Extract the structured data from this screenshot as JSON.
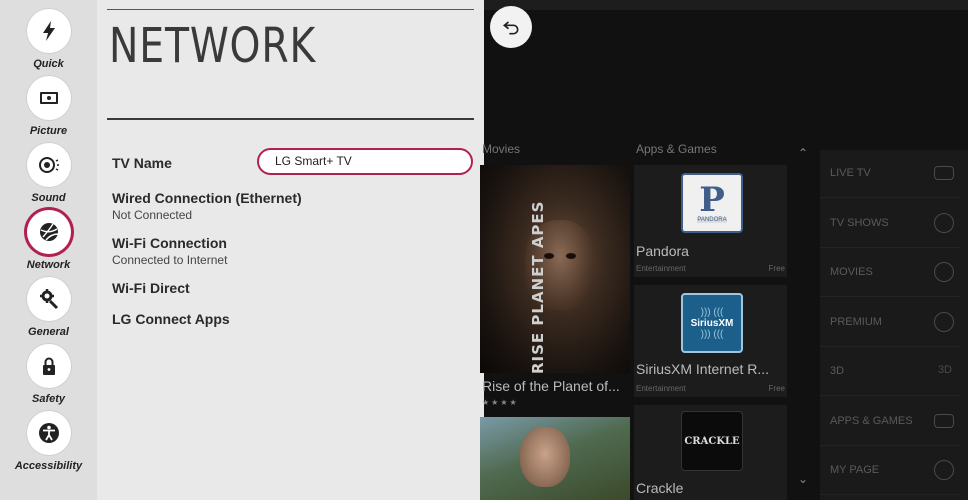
{
  "sidebar": {
    "items": [
      {
        "label": "Quick",
        "icon": "lightning-icon",
        "active": false
      },
      {
        "label": "Picture",
        "icon": "picture-icon",
        "active": false
      },
      {
        "label": "Sound",
        "icon": "sound-icon",
        "active": false
      },
      {
        "label": "Network",
        "icon": "network-globe-icon",
        "active": true
      },
      {
        "label": "General",
        "icon": "general-gear-icon",
        "active": false
      },
      {
        "label": "Safety",
        "icon": "lock-icon",
        "active": false
      },
      {
        "label": "Accessibility",
        "icon": "accessibility-icon",
        "active": false
      }
    ]
  },
  "panel": {
    "title": "NETWORK",
    "tv_name": {
      "label": "TV Name",
      "value": "LG Smart+ TV"
    },
    "wired": {
      "label": "Wired Connection (Ethernet)",
      "status": "Not Connected"
    },
    "wifi": {
      "label": "Wi-Fi Connection",
      "status": "Connected to Internet"
    },
    "wifi_direct": {
      "label": "Wi-Fi Direct"
    },
    "lg_connect": {
      "label": "LG Connect Apps"
    }
  },
  "background": {
    "sections": {
      "movies": "Movies",
      "apps": "Apps & Games"
    },
    "movies": [
      {
        "title": "Rise of the Planet of...",
        "poster_text": "RISE PLANET APES",
        "rating": 4
      }
    ],
    "apps": [
      {
        "name": "Pandora",
        "category": "Entertainment",
        "price": "Free",
        "logo_text": "PANDORA"
      },
      {
        "name": "SiriusXM Internet R...",
        "category": "Entertainment",
        "price": "Free",
        "logo_text": "SiriusXM"
      },
      {
        "name": "Crackle",
        "logo_text": "CRACKLE"
      }
    ],
    "categories": [
      "LIVE TV",
      "TV SHOWS",
      "MOVIES",
      "PREMIUM",
      "3D",
      "APPS & GAMES",
      "MY PAGE"
    ],
    "category_badge_3d": "3D"
  },
  "colors": {
    "accent": "#b1214f",
    "panel_bg": "#e9e9e9",
    "rail_bg": "#dedede"
  }
}
